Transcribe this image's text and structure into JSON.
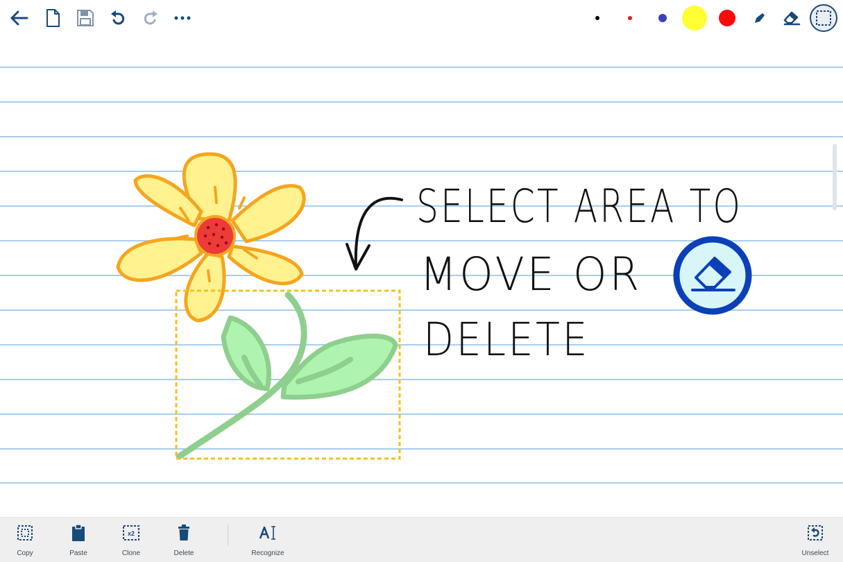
{
  "toolbar": {
    "left_icons": [
      "back-arrow-icon",
      "new-page-icon",
      "save-icon",
      "undo-icon",
      "redo-icon",
      "more-icon"
    ],
    "palette": [
      {
        "name": "black-dot",
        "color": "#000000"
      },
      {
        "name": "red-small-dot",
        "color": "#e02020"
      },
      {
        "name": "blue-dot",
        "color": "#3b44b5"
      },
      {
        "name": "yellow-highlighter",
        "color": "#ffff33"
      },
      {
        "name": "red-highlighter",
        "color": "#ff0a0a"
      }
    ],
    "right_icons": [
      "pen-icon",
      "eraser-icon",
      "select-icon"
    ],
    "accent": "#184a7a"
  },
  "canvas": {
    "line_color": "#a8cdec",
    "handwritten_text": [
      "SELECT AREA TO",
      "MOVE OR",
      "DELETE"
    ],
    "selection_color": "#f2c21f"
  },
  "actions": {
    "copy": "Copy",
    "paste": "Paste",
    "clone": "Clone",
    "clone_badge": "x2",
    "delete": "Delete",
    "recognize": "Recognize",
    "unselect": "Unselect"
  }
}
